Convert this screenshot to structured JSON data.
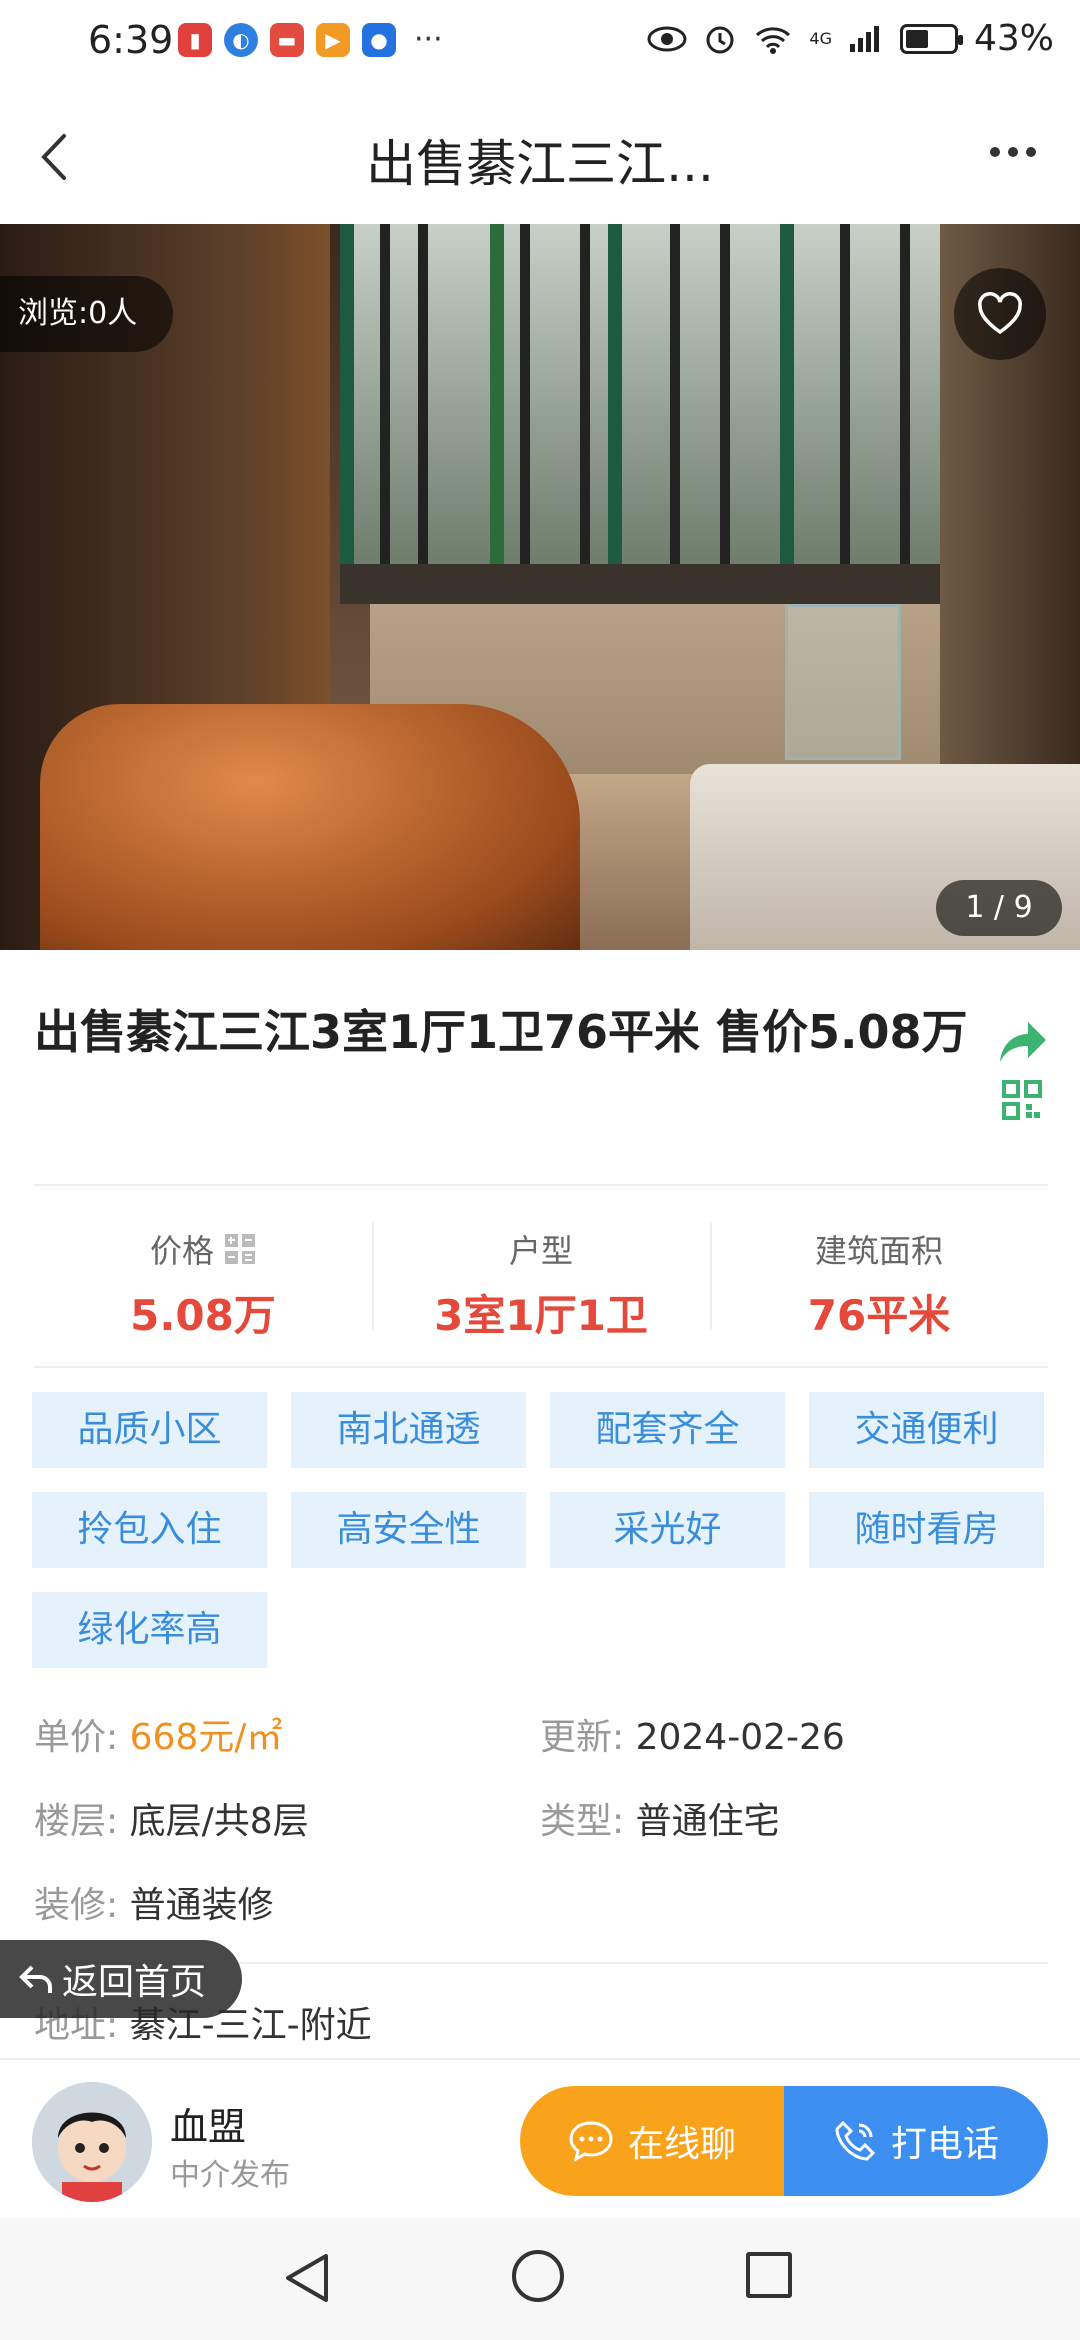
{
  "status_bar": {
    "time": "6:39",
    "network": "4G",
    "battery": "43%"
  },
  "header": {
    "title": "出售綦江三江..."
  },
  "gallery": {
    "views": "浏览:0人",
    "counter": "1 / 9"
  },
  "listing": {
    "title": "出售綦江三江3室1厅1卫76平米 售价5.08万"
  },
  "stats": [
    {
      "label": "价格",
      "value": "5.08万"
    },
    {
      "label": "户型",
      "value": "3室1厅1卫"
    },
    {
      "label": "建筑面积",
      "value": "76平米"
    }
  ],
  "tags": [
    "品质小区",
    "南北通透",
    "配套齐全",
    "交通便利",
    "拎包入住",
    "高安全性",
    "采光好",
    "随时看房",
    "绿化率高"
  ],
  "details": {
    "unit_price": {
      "label": "单价:",
      "value": "668元/㎡"
    },
    "updated": {
      "label": "更新:",
      "value": "2024-02-26"
    },
    "floor": {
      "label": "楼层:",
      "value": "底层/共8层"
    },
    "type": {
      "label": "类型:",
      "value": "普通住宅"
    },
    "decoration": {
      "label": "装修:",
      "value": "普通装修"
    },
    "address": {
      "label": "地址:",
      "value": "綦江-三江-附近"
    }
  },
  "home_button": "返回首页",
  "agent": {
    "name": "血盟",
    "role": "中介发布"
  },
  "actions": {
    "chat": "在线聊",
    "call": "打电话"
  },
  "colors": {
    "accent_red": "#e5493b",
    "tag_bg": "#e6f2fb",
    "tag_text": "#3a8ddb",
    "chat_orange": "#f9a31d",
    "call_blue": "#3c8ff0",
    "share_green": "#3cb371"
  }
}
